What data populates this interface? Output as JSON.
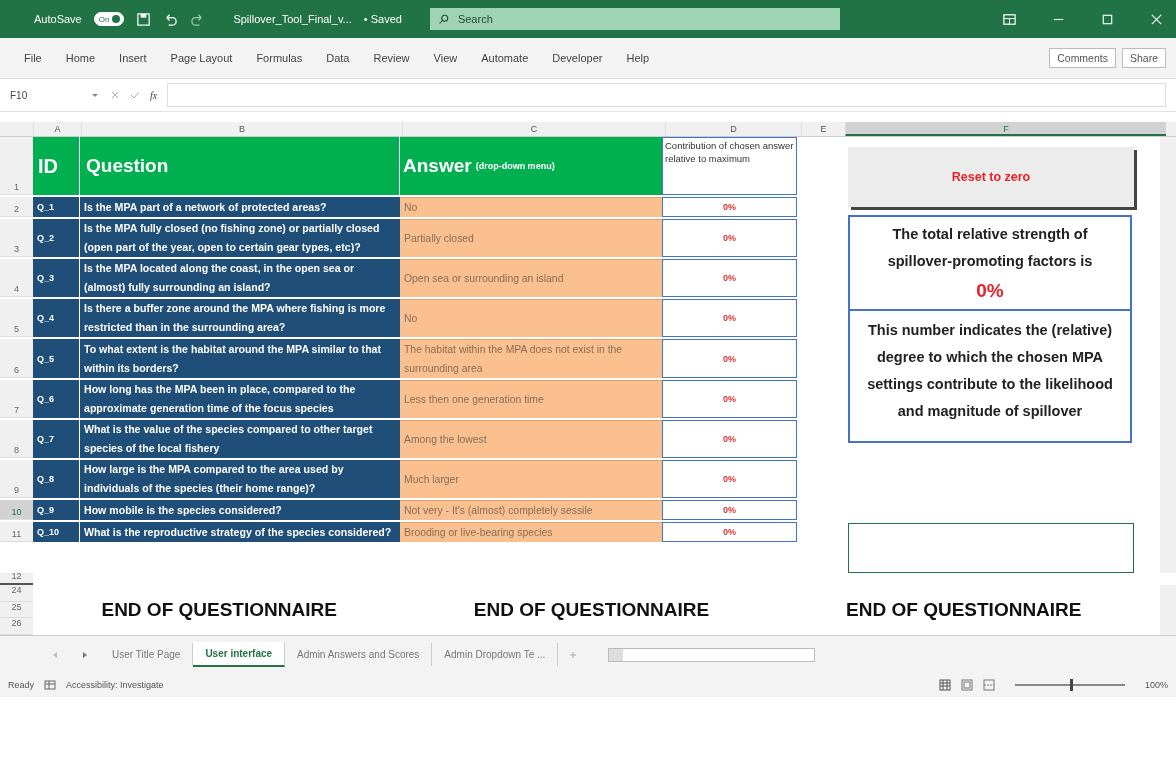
{
  "title_bar": {
    "autosave_label": "AutoSave",
    "autosave_state": "On",
    "autosave_on": true,
    "file_name": "Spillover_Tool_Final_v...",
    "saved_status": "• Saved",
    "search_placeholder": "Search"
  },
  "menu": {
    "items": [
      "File",
      "Home",
      "Insert",
      "Page Layout",
      "Formulas",
      "Data",
      "Review",
      "View",
      "Automate",
      "Developer",
      "Help"
    ],
    "comments": "Comments",
    "share": "Share"
  },
  "formula_bar": {
    "name_box": "F10",
    "function_label": "fx"
  },
  "columns": [
    {
      "label": "A",
      "selected": false
    },
    {
      "label": "B",
      "selected": false
    },
    {
      "label": "C",
      "selected": false
    },
    {
      "label": "D",
      "selected": false
    },
    {
      "label": "E",
      "selected": false
    },
    {
      "label": "F",
      "selected": true
    }
  ],
  "header": {
    "row": "1",
    "id": "ID",
    "question": "Question",
    "answer": "Answer",
    "answer_note": "(drop-down menu)",
    "contribution": "Contribution of chosen answer relative to maximum"
  },
  "rows": [
    {
      "row": "2",
      "id": "Q_1",
      "question": "Is the MPA part of a network of protected areas?",
      "answer": "No",
      "contribution": "0%",
      "selected": false
    },
    {
      "row": "3",
      "id": "Q_2",
      "question": "Is the MPA fully closed (no fishing zone) or partially closed (open part of the year, open to certain gear types, etc)?",
      "answer": "Partially closed",
      "contribution": "0%",
      "selected": false
    },
    {
      "row": "4",
      "id": "Q_3",
      "question": "Is the MPA located along the coast, in the open sea or (almost) fully surrounding an island?",
      "answer": "Open sea or surrounding an island",
      "contribution": "0%",
      "selected": false
    },
    {
      "row": "5",
      "id": "Q_4",
      "question": "Is there a buffer zone around the MPA where fishing is more restricted than in the surrounding area?",
      "answer": "No",
      "contribution": "0%",
      "selected": false
    },
    {
      "row": "6",
      "id": "Q_5",
      "question": "To what extent is the habitat around the MPA similar to that within its borders?",
      "answer": "The habitat within the MPA does not exist in the surrounding area",
      "contribution": "0%",
      "selected": false
    },
    {
      "row": "7",
      "id": "Q_6",
      "question": "How long has the MPA been in place, compared to the approximate generation time of the focus species",
      "answer": "Less then one generation time",
      "contribution": "0%",
      "selected": false
    },
    {
      "row": "8",
      "id": "Q_7",
      "question": "What is the value of the species compared to other target species of the local fishery",
      "answer": "Among the lowest",
      "contribution": "0%",
      "selected": false
    },
    {
      "row": "9",
      "id": "Q_8",
      "question": "How large is the MPA compared to the area used by individuals of the species (their home range)?",
      "answer": "Much larger",
      "contribution": "0%",
      "selected": false
    },
    {
      "row": "10",
      "id": "Q_9",
      "question": "How mobile is the species considered?",
      "answer": "Not very - It's (almost) completely sessile",
      "contribution": "0%",
      "selected": true
    },
    {
      "row": "11",
      "id": "Q_10",
      "question": "What is the reproductive strategy of the species considered?",
      "answer": "Brooding or live-bearing species",
      "contribution": "0%",
      "selected": false
    }
  ],
  "panel": {
    "reset_button": "Reset to zero",
    "total_label": "The total relative strength of spillover-promoting factors is",
    "total_value": "0%",
    "explanation": "This number indicates the (relative) degree to which the chosen MPA settings contribute to the likelihood and magnitude of spillover"
  },
  "blank_rows": [
    "12"
  ],
  "footer_rows": [
    "24",
    "25",
    "26"
  ],
  "footer_texts": [
    "END OF QUESTIONNAIRE",
    "END OF QUESTIONNAIRE",
    "END OF QUESTIONNAIRE"
  ],
  "sheet_tabs": [
    {
      "label": "User Title Page",
      "selected": false
    },
    {
      "label": "User interface",
      "selected": true
    },
    {
      "label": "Admin Answers and Scores",
      "selected": false
    },
    {
      "label": "Admin Dropdown Te ...",
      "selected": false
    }
  ],
  "status_bar": {
    "ready": "Ready",
    "accessibility": "Accessibility: Investigate",
    "zoom": "100%",
    "level": 0.5
  }
}
